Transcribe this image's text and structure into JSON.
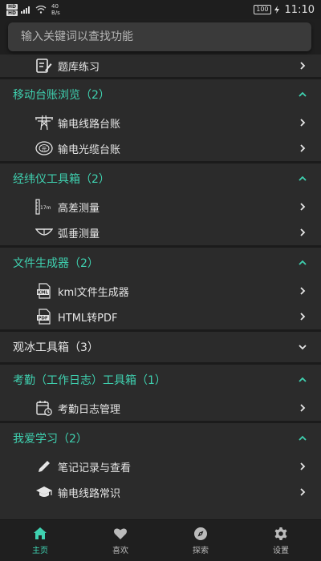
{
  "status_bar": {
    "hd1": "HD",
    "hd2": "HD",
    "net_speed_value": "40",
    "net_speed_unit": "B/s",
    "battery": "100",
    "time": "11:10"
  },
  "search": {
    "placeholder": "输入关键词以查找功能"
  },
  "top_item": {
    "label": "题库练习"
  },
  "sections": [
    {
      "title": "移动台账浏览（2）",
      "expanded": true,
      "items": [
        {
          "label": "输电线路台账",
          "icon": "tower-icon"
        },
        {
          "label": "输电光缆台账",
          "icon": "optical-cable-icon"
        }
      ]
    },
    {
      "title": "经纬仪工具箱（2）",
      "expanded": true,
      "items": [
        {
          "label": "高差测量",
          "icon": "ruler-icon",
          "icon_text": "17m"
        },
        {
          "label": "弧垂测量",
          "icon": "sag-icon"
        }
      ]
    },
    {
      "title": "文件生成器（2）",
      "expanded": true,
      "items": [
        {
          "label": "kml文件生成器",
          "icon": "kml-file-icon",
          "icon_text": "KML"
        },
        {
          "label": "HTML转PDF",
          "icon": "pdf-file-icon",
          "icon_text": "PDF"
        }
      ]
    },
    {
      "title": "观冰工具箱（3）",
      "expanded": false,
      "items": []
    },
    {
      "title": "考勤（工作日志）工具箱（1）",
      "expanded": true,
      "items": [
        {
          "label": "考勤日志管理",
          "icon": "calendar-clock-icon"
        }
      ]
    },
    {
      "title": "我爱学习（2）",
      "expanded": true,
      "items": [
        {
          "label": "笔记记录与查看",
          "icon": "pencil-icon"
        },
        {
          "label": "输电线路常识",
          "icon": "graduation-cap-icon"
        }
      ]
    }
  ],
  "tabs": [
    {
      "label": "主页",
      "icon": "home-icon",
      "active": true
    },
    {
      "label": "喜欢",
      "icon": "heart-icon",
      "active": false
    },
    {
      "label": "探索",
      "icon": "compass-icon",
      "active": false
    },
    {
      "label": "设置",
      "icon": "gear-icon",
      "active": false
    }
  ],
  "colors": {
    "accent": "#3fd1b0",
    "background": "#2b2b2b",
    "bar": "#1f1f1f"
  }
}
